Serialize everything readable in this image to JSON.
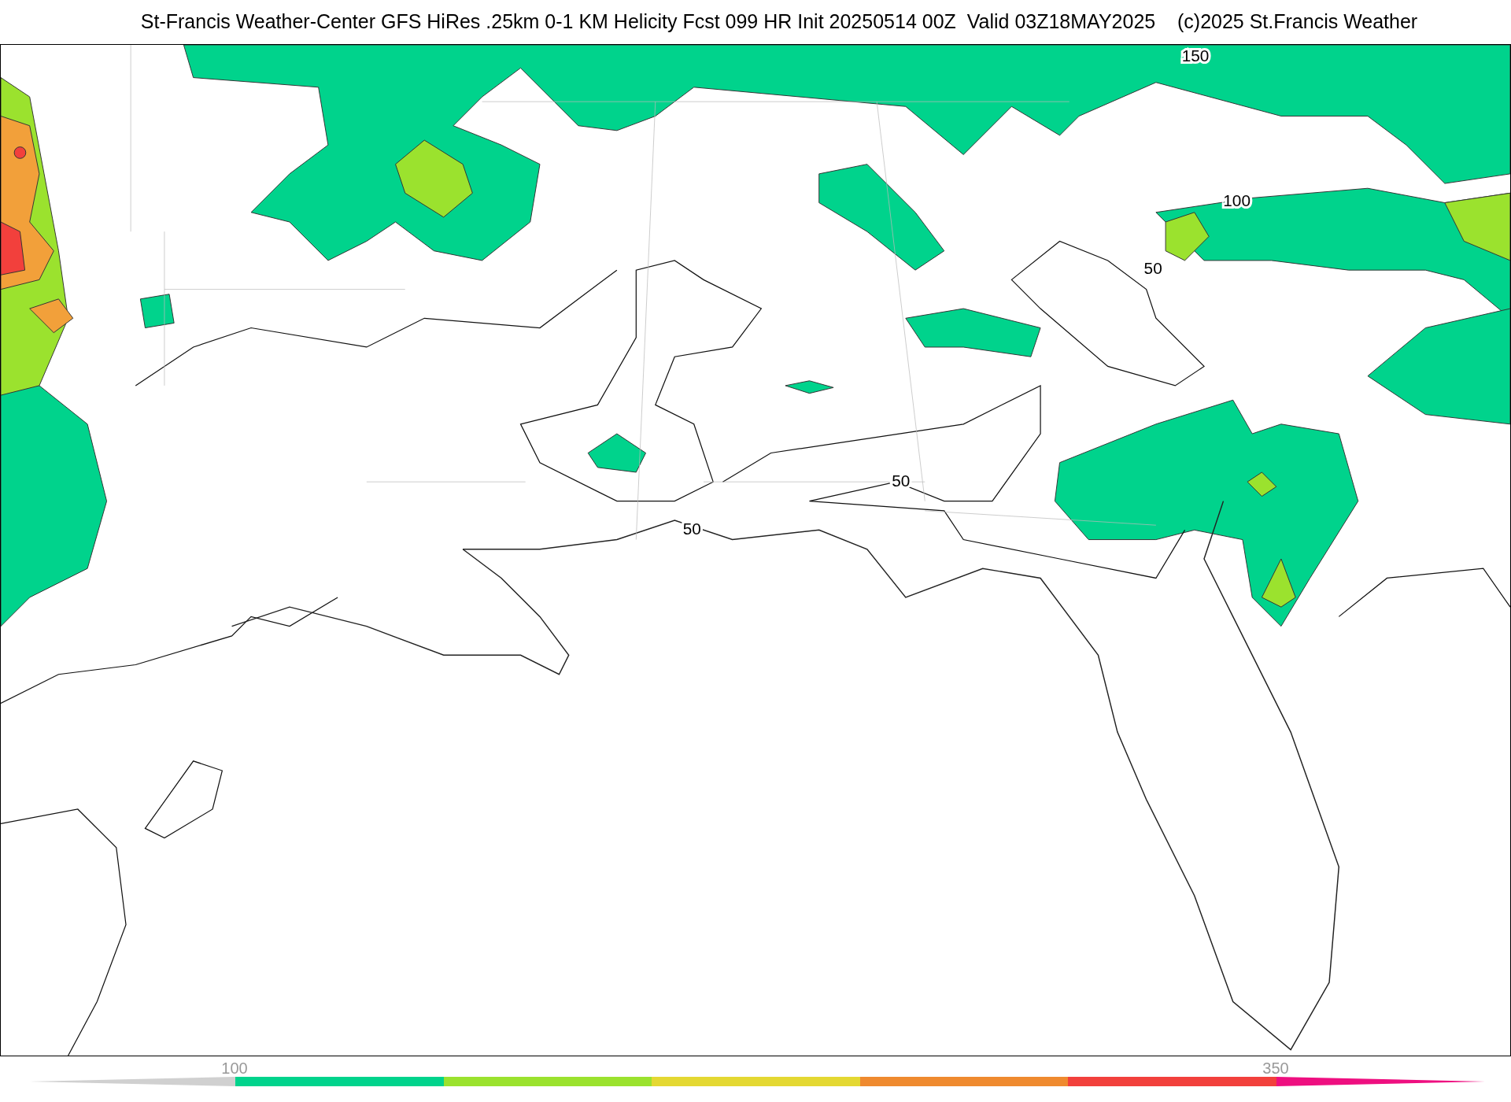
{
  "title": "St-Francis Weather-Center GFS HiRes .25km 0-1 KM Helicity Fcst 099 HR Init 20250514 00Z  Valid 03Z18MAY2025    (c)2025 St.Francis Weather",
  "map": {
    "contour_labels": [
      {
        "text": "150"
      },
      {
        "text": "100"
      },
      {
        "text": "50"
      },
      {
        "text": "50"
      },
      {
        "text": "50"
      }
    ]
  },
  "colorbar": {
    "labels": [
      {
        "text": "100"
      },
      {
        "text": "350"
      }
    ],
    "segments": [
      {
        "kind": "start",
        "color": "#d0d0d0"
      },
      {
        "kind": "band",
        "color": "#00d38c"
      },
      {
        "kind": "band",
        "color": "#9be22e"
      },
      {
        "kind": "band",
        "color": "#e4d832"
      },
      {
        "kind": "band",
        "color": "#ef8a2f"
      },
      {
        "kind": "band",
        "color": "#f2403c"
      },
      {
        "kind": "end",
        "color": "#ee0f80"
      }
    ]
  }
}
